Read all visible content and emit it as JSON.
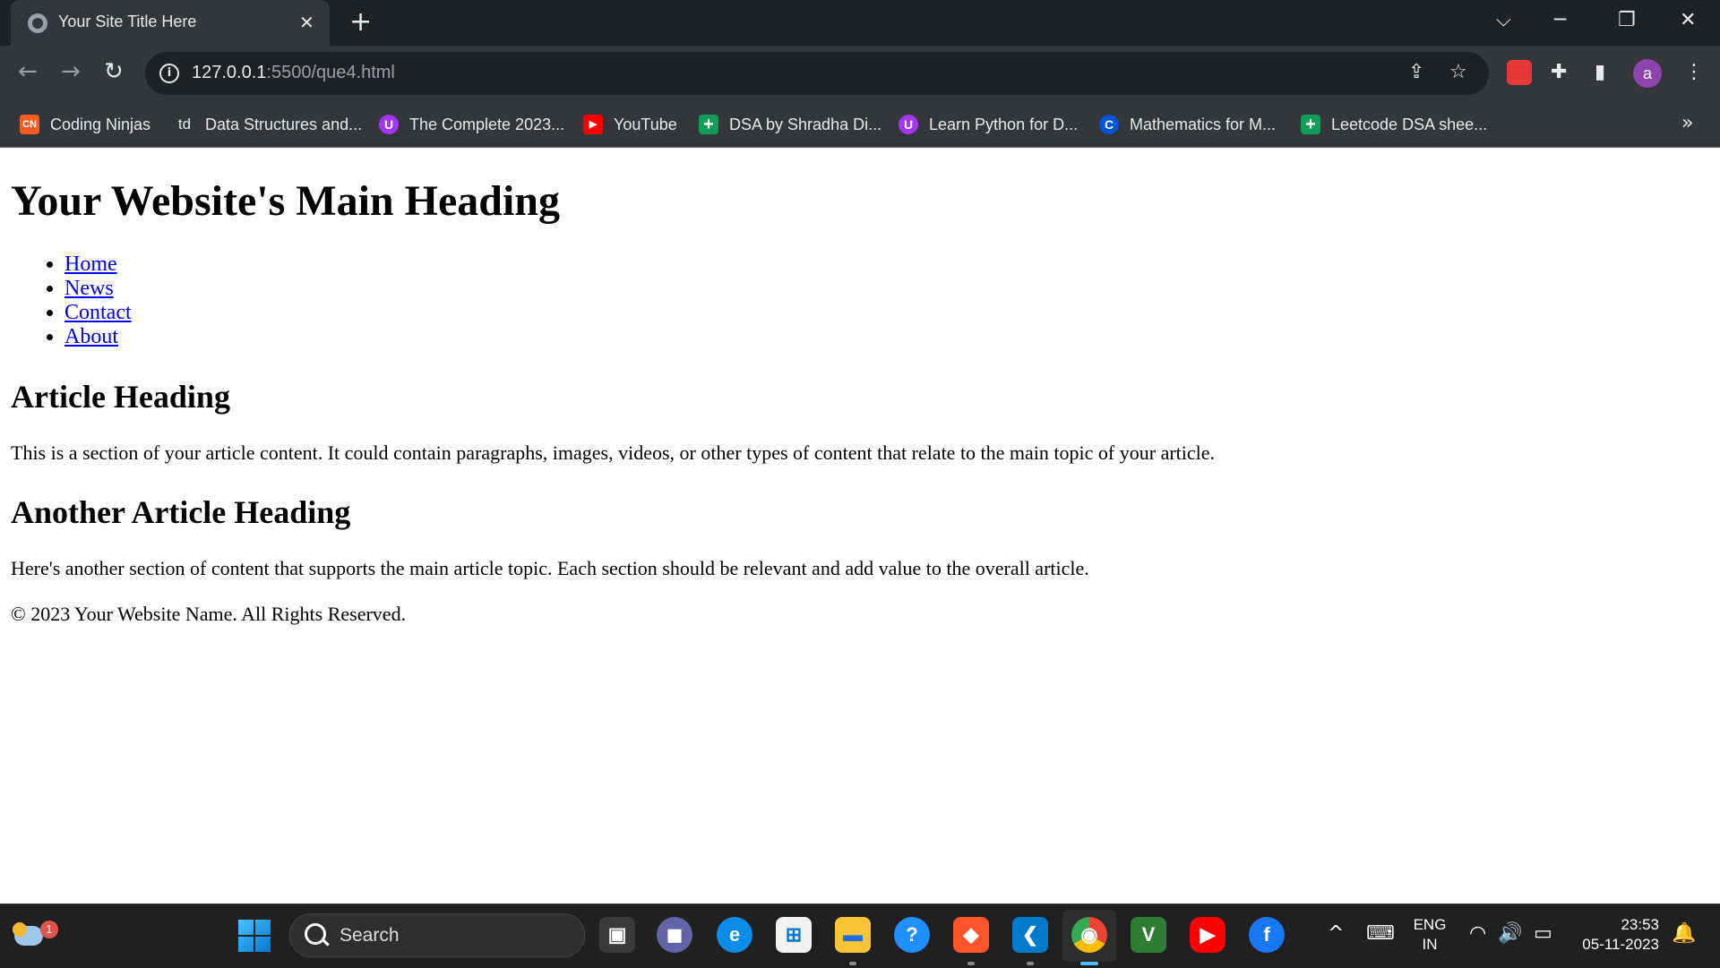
{
  "browser": {
    "tab": {
      "title": "Your Site Title Here",
      "close_glyph": "✕"
    },
    "new_tab_glyph": "+",
    "window_controls": {
      "dropdown": "⌵",
      "minimize": "─",
      "restore": "❐",
      "close": "✕"
    },
    "nav": {
      "back": "←",
      "forward": "→",
      "reload": "↻"
    },
    "omnibox": {
      "info_glyph": "i",
      "url_host": "127.0.0.1",
      "url_path": ":5500/que4.html"
    },
    "omnibox_icons": {
      "share": "⇪",
      "star": "☆"
    },
    "extensions": {
      "puzzle": "✚",
      "sidepanel": "▮",
      "menu": "⋮"
    },
    "profile_initial": "a",
    "bookmarks": [
      {
        "label": "Coding Ninjas",
        "icon": "coding-ninjas-icon",
        "icon_text": "CN",
        "color": "#f45d22"
      },
      {
        "label": "Data Structures and...",
        "icon": "td-icon",
        "icon_text": "td",
        "color": "#35363a"
      },
      {
        "label": "The Complete 2023...",
        "icon": "udemy-icon",
        "icon_text": "U",
        "color": "#a435f0"
      },
      {
        "label": "YouTube",
        "icon": "youtube-icon",
        "icon_text": "▶",
        "color": "#ff0000"
      },
      {
        "label": "DSA by Shradha Di...",
        "icon": "sheets-icon",
        "icon_text": "+",
        "color": "#0f9d58"
      },
      {
        "label": "Learn Python for D...",
        "icon": "udemy-icon",
        "icon_text": "U",
        "color": "#a435f0"
      },
      {
        "label": "Mathematics for M...",
        "icon": "coursera-icon",
        "icon_text": "C",
        "color": "#0056d2"
      },
      {
        "label": "Leetcode DSA shee...",
        "icon": "sheets-icon",
        "icon_text": "+",
        "color": "#0f9d58"
      }
    ],
    "bookmarks_more": "»"
  },
  "page": {
    "main_heading": "Your Website's Main Heading",
    "nav_links": [
      "Home",
      "News",
      "Contact",
      "About"
    ],
    "sections": [
      {
        "heading": "Article Heading",
        "body": "This is a section of your article content. It could contain paragraphs, images, videos, or other types of content that relate to the main topic of your article."
      },
      {
        "heading": "Another Article Heading",
        "body": "Here's another section of content that supports the main article topic. Each section should be relevant and add value to the overall article."
      }
    ],
    "footer": "© 2023 Your Website Name. All Rights Reserved."
  },
  "taskbar": {
    "weather_badge": "1",
    "search_label": "Search",
    "apps": [
      {
        "name": "task-view-icon",
        "glyph": "▣",
        "color": "#3a3a3a"
      },
      {
        "name": "teams-icon",
        "glyph": "◼",
        "color": "#6264a7"
      },
      {
        "name": "edge-icon",
        "glyph": "e",
        "color": "#0c8ce9"
      },
      {
        "name": "store-icon",
        "glyph": "⊞",
        "color": "#f3f3f3"
      },
      {
        "name": "file-explorer-icon",
        "glyph": "▬",
        "color": "#f8c537"
      },
      {
        "name": "help-icon",
        "glyph": "?",
        "color": "#1e90ff"
      },
      {
        "name": "brave-icon",
        "glyph": "◆",
        "color": "#fb542b"
      },
      {
        "name": "vscode-icon",
        "glyph": "❮",
        "color": "#007acc"
      },
      {
        "name": "chrome-icon",
        "glyph": "◉",
        "color": "#34a853"
      },
      {
        "name": "vite-icon",
        "glyph": "V",
        "color": "#2e7d32"
      },
      {
        "name": "youtube-icon",
        "glyph": "▶",
        "color": "#ff0000"
      },
      {
        "name": "facebook-icon",
        "glyph": "f",
        "color": "#1877f2"
      }
    ],
    "tray": {
      "chevron": "^",
      "keyboard": "⌨",
      "lang_line1": "ENG",
      "lang_line2": "IN",
      "wifi": "◠",
      "volume": "🔊",
      "battery": "▭",
      "time": "23:53",
      "date": "05-11-2023",
      "bell": "🔔"
    }
  }
}
